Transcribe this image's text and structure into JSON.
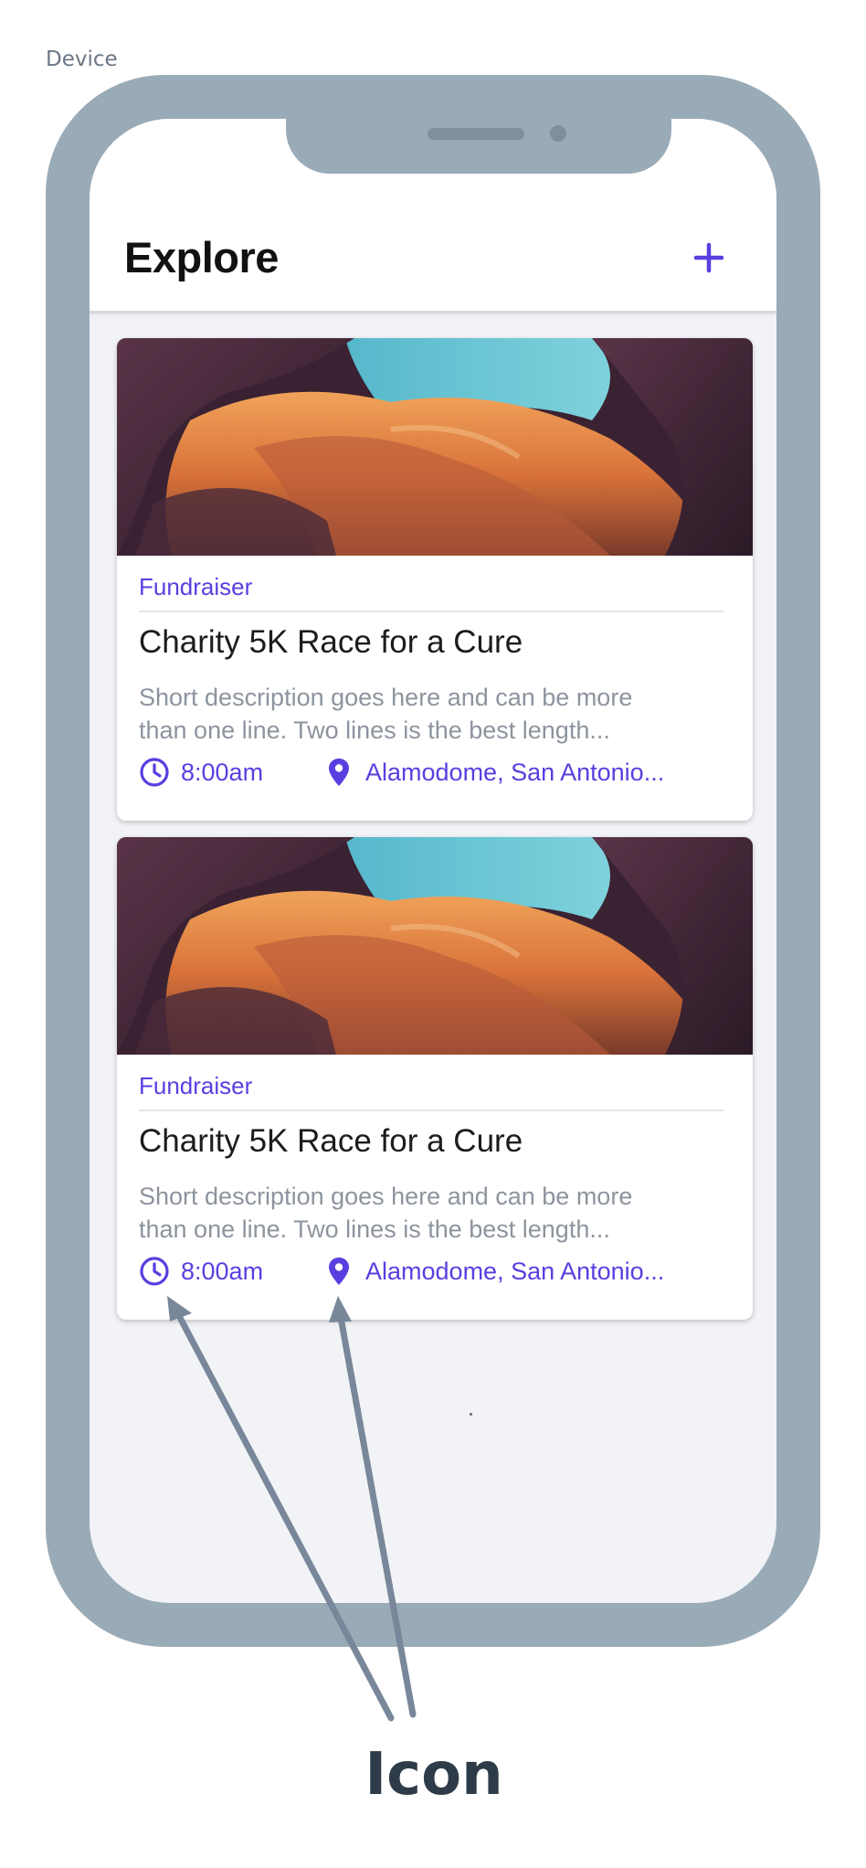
{
  "device": {
    "label": "Device"
  },
  "header": {
    "title": "Explore",
    "add_icon": "plus-icon"
  },
  "cards": [
    {
      "category": "Fundraiser",
      "title": "Charity 5K Race for a Cure",
      "description": "Short description goes here and can be more\nthan one line. Two lines is the best length...",
      "time": "8:00am",
      "location": "Alamodome, San Antonio...",
      "time_icon": "clock-icon",
      "location_icon": "map-pin-icon"
    },
    {
      "category": "Fundraiser",
      "title": "Charity 5K Race for a Cure",
      "description": "Short description goes here and can be more\nthan one line. Two lines is the best length...",
      "time": "8:00am",
      "location": "Alamodome, San Antonio...",
      "time_icon": "clock-icon",
      "location_icon": "map-pin-icon"
    }
  ],
  "annotation": {
    "label": "Icon"
  },
  "colors": {
    "accent": "#5a3ee0",
    "device_frame": "#9aabb8",
    "annotation": "#78889a"
  }
}
